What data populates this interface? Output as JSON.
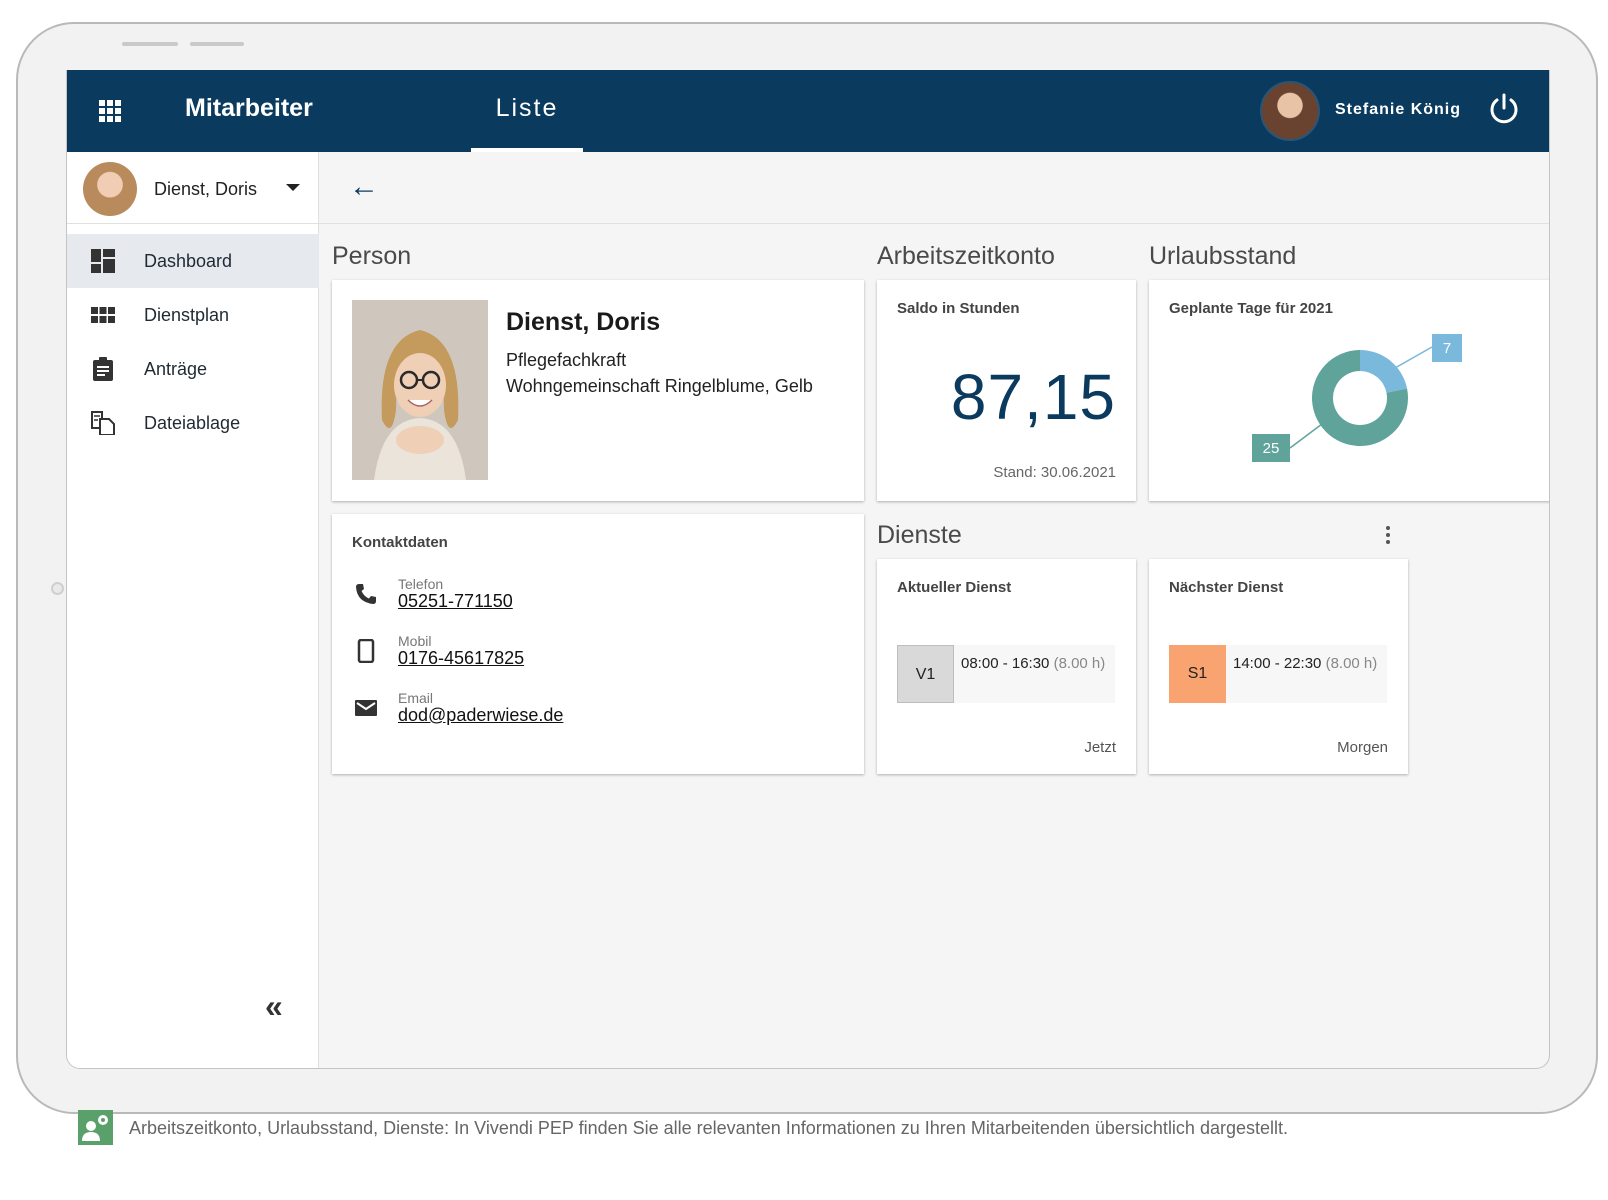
{
  "app": {
    "title": "Mitarbeiter",
    "tab": "Liste",
    "user_name": "Stefanie König"
  },
  "employee_selector": {
    "name": "Dienst, Doris"
  },
  "nav": [
    {
      "label": "Dashboard",
      "icon": "dashboard-icon"
    },
    {
      "label": "Dienstplan",
      "icon": "grid-icon"
    },
    {
      "label": "Anträge",
      "icon": "clipboard-icon"
    },
    {
      "label": "Dateiablage",
      "icon": "documents-icon"
    }
  ],
  "collapse_label": "«",
  "back_label": "←",
  "person": {
    "section_title": "Person",
    "name": "Dienst, Doris",
    "role": "Pflegefachkraft",
    "unit": "Wohngemeinschaft Ringelblume, Gelb"
  },
  "contact": {
    "title": "Kontaktdaten",
    "items": [
      {
        "label": "Telefon",
        "value": "05251-771150",
        "icon": "phone-icon"
      },
      {
        "label": "Mobil",
        "value": "0176-45617825",
        "icon": "smartphone-icon"
      },
      {
        "label": "Email",
        "value": "dod@paderwiese.de",
        "icon": "mail-icon"
      }
    ]
  },
  "arbeitszeitkonto": {
    "section_title": "Arbeitszeitkonto",
    "subtitle": "Saldo in Stunden",
    "value": "87,15",
    "date": "Stand: 30.06.2021"
  },
  "urlaub": {
    "section_title": "Urlaubsstand",
    "subtitle": "Geplante Tage für 2021",
    "label_small": "7",
    "label_large": "25",
    "colors": {
      "small": "#7ab8dc",
      "large": "#5fa39a"
    }
  },
  "chart_data": {
    "type": "pie",
    "title": "Geplante Tage für 2021",
    "values": [
      7,
      25
    ],
    "colors": [
      "#7ab8dc",
      "#5fa39a"
    ],
    "donut": true
  },
  "dienste": {
    "section_title": "Dienste",
    "current": {
      "title": "Aktueller Dienst",
      "code": "V1",
      "time": "08:00 - 16:30",
      "duration": "(8.00 h)",
      "when": "Jetzt",
      "color": "#d9d9d9"
    },
    "next": {
      "title": "Nächster Dienst",
      "code": "S1",
      "time": "14:00 - 22:30",
      "duration": "(8.00 h)",
      "when": "Morgen",
      "color": "#f9a470"
    }
  },
  "caption": "Arbeitszeitkonto, Urlaubsstand, Dienste: In Vivendi PEP finden Sie alle relevanten Informationen zu Ihren Mitarbeitenden übersichtlich dargestellt."
}
